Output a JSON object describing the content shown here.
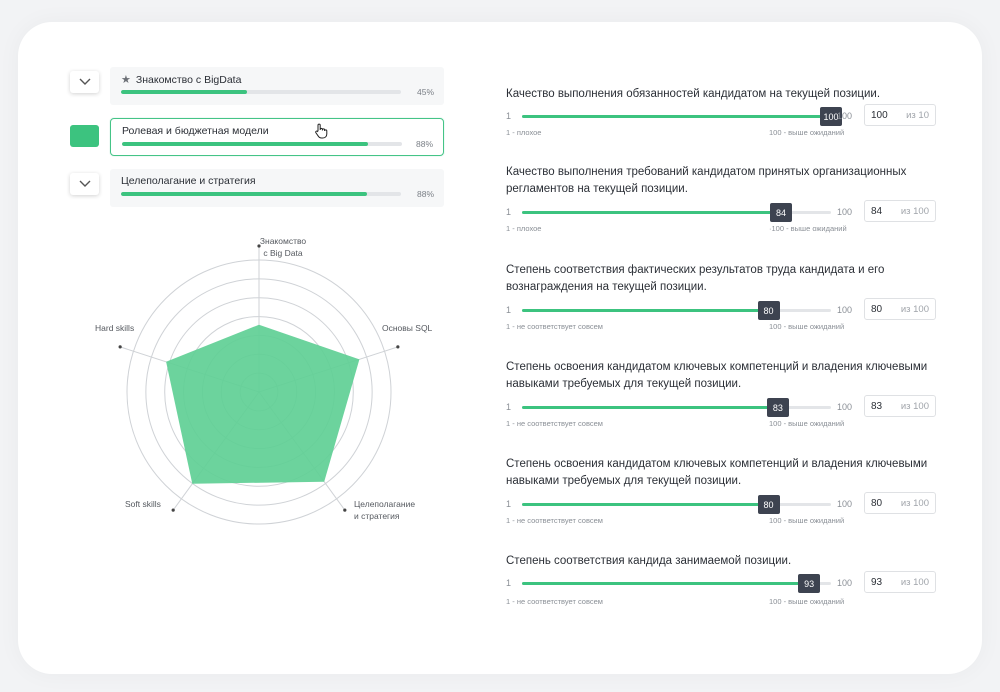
{
  "colors": {
    "accent": "#3cc37f",
    "thumb": "#3d4350",
    "radar_fill": "#5fcf95"
  },
  "courses": [
    {
      "title": "Знакомство с BigData",
      "percent_label": "45%",
      "progress": 0.45,
      "starred": true
    },
    {
      "title": "Ролевая и бюджетная модели",
      "percent_label": "88%",
      "progress": 0.88,
      "selected": true
    },
    {
      "title": "Целеполагание и стратегия",
      "percent_label": "88%",
      "progress": 0.88
    }
  ],
  "radar": {
    "axes": [
      {
        "label_lines": [
          "Знакомство",
          "с Big Data"
        ],
        "value": 0.51
      },
      {
        "label_lines": [
          "Основы SQL"
        ],
        "value": 0.8
      },
      {
        "label_lines": [
          "Целеполагание",
          "и стратегия"
        ],
        "value": 0.84
      },
      {
        "label_lines": [
          "Soft skills"
        ],
        "value": 0.86
      },
      {
        "label_lines": [
          "Hard skills"
        ],
        "value": 0.74
      }
    ],
    "rings": 7
  },
  "questions": [
    {
      "title": "Качество выполнения обязанностей кандидатом на текущей позиции.",
      "value": 100,
      "min_label": "1",
      "max_label": "100",
      "box_value": "100",
      "box_suffix": "из 10",
      "hint_left": "1 - плохое",
      "hint_right": "100 - выше ожиданий"
    },
    {
      "title": "Качество выполнения требований кандидатом принятых организационных регламентов на текущей позиции.",
      "value": 84,
      "min_label": "1",
      "max_label": "100",
      "box_value": "84",
      "box_suffix": "из 100",
      "hint_left": "1 - плохое",
      "hint_right": "·100 - выше ожиданий"
    },
    {
      "title": "Степень соответствия фактических результатов труда кандидата и его вознаграждения на текущей позиции.",
      "value": 80,
      "min_label": "1",
      "max_label": "100",
      "box_value": "80",
      "box_suffix": "из 100",
      "hint_left": "1 - не соответствует совсем",
      "hint_right": "100 - выше ожиданий"
    },
    {
      "title": "Степень освоения кандидатом ключевых компетенций и владения ключевыми навыками требуемых для текущей позиции.",
      "value": 83,
      "min_label": "1",
      "max_label": "100",
      "box_value": "83",
      "box_suffix": "из 100",
      "hint_left": "1 - не соответствует совсем",
      "hint_right": "100 - выше ожиданий"
    },
    {
      "title": "Степень освоения кандидатом ключевых компетенций и владения ключевыми навыками требуемых для текущей позиции.",
      "value": 80,
      "min_label": "1",
      "max_label": "100",
      "box_value": "80",
      "box_suffix": "из 100",
      "hint_left": "1 - не соответствует совсем",
      "hint_right": "100 - выше ожиданий"
    },
    {
      "title": "Степень соответствия кандида занимаемой позиции.",
      "value": 93,
      "min_label": "1",
      "max_label": "100",
      "box_value": "93",
      "box_suffix": "из 100",
      "hint_left": "1 - не соответствует совсем",
      "hint_right": "100 - выше ожиданий"
    }
  ]
}
